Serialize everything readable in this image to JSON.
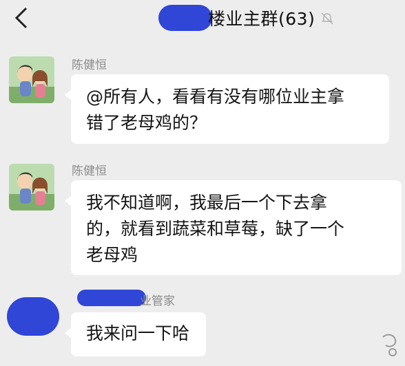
{
  "header": {
    "title": "楼业主群(63)",
    "back_icon": "chevron-left-icon",
    "mute_icon": "bell-mute-icon"
  },
  "messages": [
    {
      "sender": "陈健恒",
      "lines": [
        "@所有人，看看有没有哪位业主拿",
        "错了老母鸡的？"
      ]
    },
    {
      "sender": "陈健恒",
      "lines": [
        "我不知道啊，我最后一个下去拿",
        "的，就看到蔬菜和草莓，缺了一个",
        "老母鸡"
      ]
    },
    {
      "sender": "业管家",
      "lines": [
        "我来问一下哈"
      ]
    }
  ],
  "colors": {
    "redaction": "#2f46d6",
    "background": "#ededed",
    "bubble": "#ffffff"
  }
}
